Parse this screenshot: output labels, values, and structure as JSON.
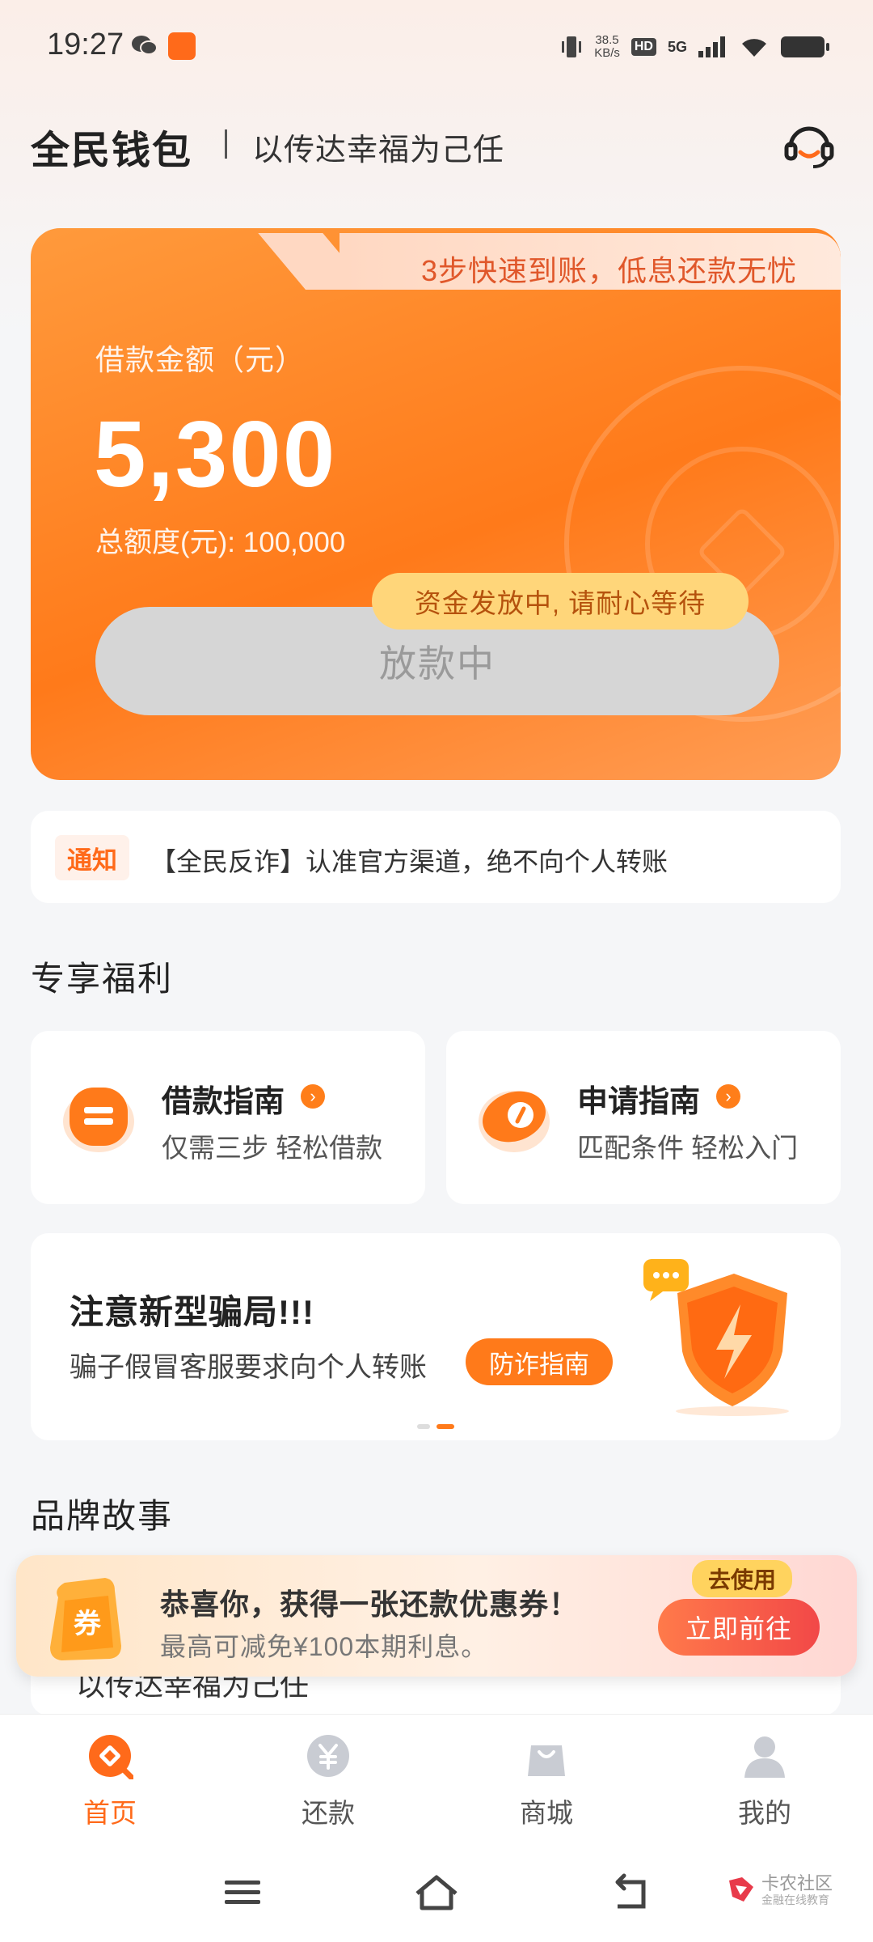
{
  "status_bar": {
    "time": "19:27",
    "net_speed_value": "38.5",
    "net_speed_unit": "KB/s",
    "hd_label": "HD",
    "network_label": "5G"
  },
  "header": {
    "app_name": "全民钱包",
    "slogan": "以传达幸福为己任"
  },
  "loan_card": {
    "tab_text": "3步快速到账，低息还款无忧",
    "amount_label": "借款金额（元）",
    "amount": "5,300",
    "total_quota": "总额度(元): 100,000",
    "tip": "资金发放中, 请耐心等待",
    "button_label": "放款中"
  },
  "notice": {
    "tag": "通知",
    "text": "【全民反诈】认准官方渠道，绝不向个人转账"
  },
  "benefits": {
    "section_title": "专享福利",
    "items": [
      {
        "title": "借款指南",
        "desc": "仅需三步 轻松借款"
      },
      {
        "title": "申请指南",
        "desc": "匹配条件 轻松入门"
      }
    ]
  },
  "fraud_banner": {
    "title": "注意新型骗局!!!",
    "desc": "骗子假冒客服要求向个人转账",
    "button_label": "防诈指南"
  },
  "brand_story": {
    "section_title": "品牌故事",
    "card_text": "以传达幸福为己任"
  },
  "coupon": {
    "badge": "去使用",
    "title": "恭喜你，获得一张还款优惠券！",
    "desc": "最高可减免¥100本期利息。",
    "button_label": "立即前往",
    "icon_text": "券"
  },
  "bottom_nav": {
    "items": [
      {
        "label": "首页"
      },
      {
        "label": "还款"
      },
      {
        "label": "商城"
      },
      {
        "label": "我的"
      }
    ]
  },
  "watermark": {
    "main": "卡农社区",
    "sub": "金融在线教育"
  },
  "colors": {
    "accent": "#ff7a1a",
    "accent_text": "#ff6a1a",
    "card_tab_text": "#e0572a",
    "tip_bg": "#ffd67a",
    "disabled_button_bg": "#d6d6d6"
  }
}
